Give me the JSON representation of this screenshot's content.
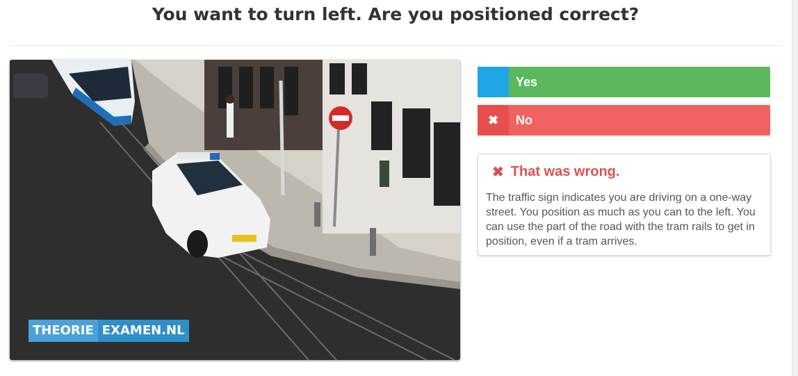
{
  "question": {
    "title": "You want to turn left. Are you positioned correct?"
  },
  "image": {
    "watermark_part1": "THEORIE",
    "watermark_part2": "EXAMEN.NL"
  },
  "answers": [
    {
      "label": "Yes",
      "marker": "",
      "color": "#5cb85c",
      "marker_color": "#1fa6e6"
    },
    {
      "label": "No",
      "marker": "✖",
      "color": "#f0625f",
      "marker_color": "#e84f4c"
    }
  ],
  "feedback": {
    "icon": "✖",
    "heading": "That was wrong.",
    "text": "The traffic sign indicates you are driving on a one-way street. You position as much as you can to the left. You can use the part of the road with the tram rails to get in position, even if a tram arrives.",
    "color": "#d9534f"
  }
}
